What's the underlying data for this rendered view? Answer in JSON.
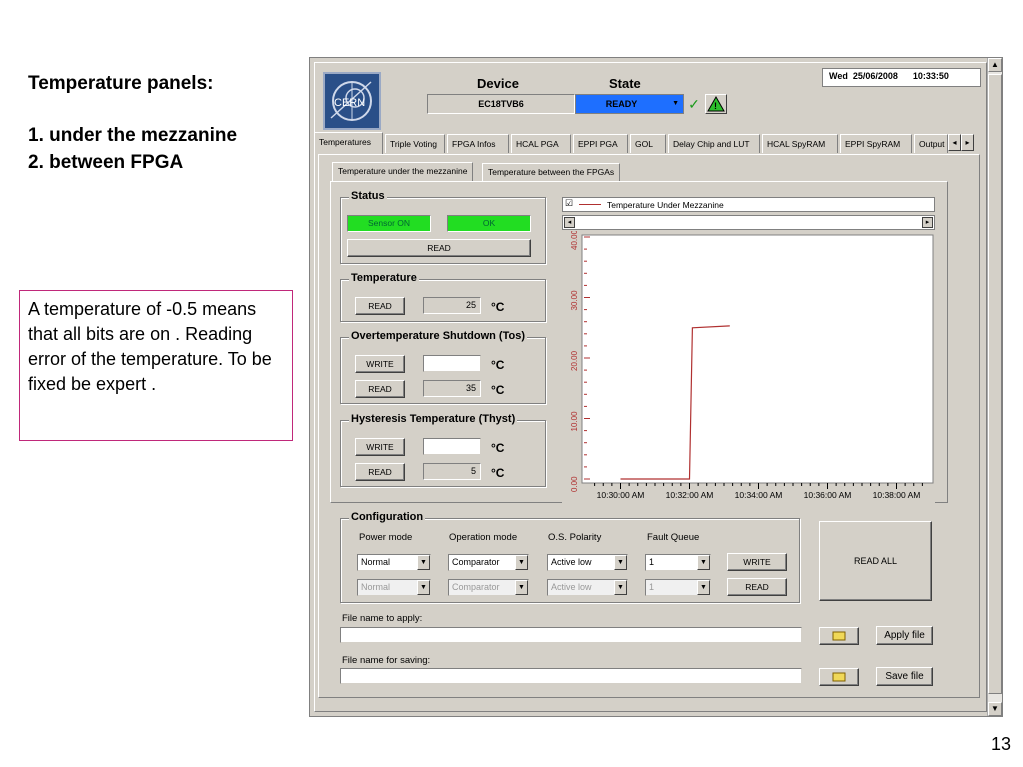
{
  "slide": {
    "title": "Temperature panels:",
    "list": [
      "1. under the mezzanine",
      "2. between FPGA"
    ],
    "note": "A temperature of -0.5 means that all bits are on . Reading error of the temperature. To be fixed be expert .",
    "page_number": "13"
  },
  "app": {
    "logo": "CERN",
    "device_label": "Device",
    "device_value": "EC18TVB6",
    "state_label": "State",
    "state_value": "READY",
    "datetime": "Wed  25/06/2008      10:33:50",
    "tabs": [
      "Temperatures",
      "Triple Voting",
      "FPGA Infos",
      "HCAL PGA",
      "EPPI PGA",
      "GOL",
      "Delay Chip and LUT",
      "HCAL SpyRAM",
      "EPPI SpyRAM",
      "Output"
    ],
    "subtabs": [
      "Temperature under the mezzanine",
      "Temperature between the FPGAs"
    ],
    "status": {
      "title": "Status",
      "sensor": "Sensor ON",
      "ok": "OK",
      "read": "READ"
    },
    "temperature": {
      "title": "Temperature",
      "read": "READ",
      "value": "25",
      "unit": "°C"
    },
    "tos": {
      "title": "Overtemperature Shutdown (Tos)",
      "write": "WRITE",
      "read": "READ",
      "value": "35",
      "unit": "°C"
    },
    "thyst": {
      "title": "Hysteresis Temperature (Thyst)",
      "write": "WRITE",
      "read": "READ",
      "value": "5",
      "unit": "°C"
    },
    "configuration": {
      "title": "Configuration",
      "headers": [
        "Power mode",
        "Operation mode",
        "O.S. Polarity",
        "Fault Queue"
      ],
      "row1": [
        "Normal",
        "Comparator",
        "Active low",
        "1"
      ],
      "row2": [
        "Normal",
        "Comparator",
        "Active low",
        "1"
      ],
      "write": "WRITE",
      "read": "READ"
    },
    "read_all": "READ ALL",
    "file_apply_label": "File name to apply:",
    "file_save_label": "File name for saving:",
    "apply_file": "Apply file",
    "save_file": "Save file"
  },
  "colors": {
    "window_bg": "#d4d0c8",
    "state_bg": "#1e6fff",
    "led_green": "#22dd22",
    "series_color": "#b03030",
    "note_border": "#c0287a"
  },
  "chart_data": {
    "type": "line",
    "series": [
      {
        "name": "Temperature Under Mezzanine",
        "x": [
          "10:30:00 AM",
          "10:32:00 AM",
          "10:32:05 AM",
          "10:33:10 AM"
        ],
        "y": [
          0,
          0,
          25,
          25.3
        ]
      }
    ],
    "ylim": [
      0,
      40
    ],
    "y_ticks": [
      "0.00",
      "10.00",
      "20.00",
      "30.00",
      "40.00"
    ],
    "x_ticks": [
      "10:30:00 AM",
      "10:32:00 AM",
      "10:34:00 AM",
      "10:36:00 AM",
      "10:38:00 AM"
    ],
    "legend_position": "top"
  }
}
